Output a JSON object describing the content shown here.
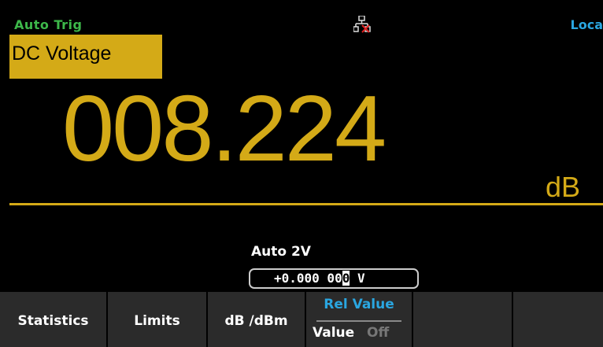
{
  "status": {
    "trigger": "Auto Trig",
    "network_icon": "lan-disconnected-icon",
    "remote_state": "Loca"
  },
  "measurement": {
    "function": "DC Voltage",
    "reading": "008.224",
    "unit": "dB",
    "range": "Auto 2V",
    "rel_value_prefix": "+0.000 00",
    "rel_value_cursor": "0",
    "rel_value_unit": " V"
  },
  "softkeys": [
    {
      "label": "Statistics"
    },
    {
      "label": "Limits"
    },
    {
      "label": "dB /dBm"
    },
    {
      "label": "Rel Value",
      "sub_label": "Value",
      "state": "Off"
    },
    {
      "label": ""
    },
    {
      "label": ""
    }
  ],
  "colors": {
    "primary": "#d4aa17",
    "trigger": "#3db84a",
    "remote": "#2aa6e0",
    "softkey_bg": "#2b2b2b"
  }
}
